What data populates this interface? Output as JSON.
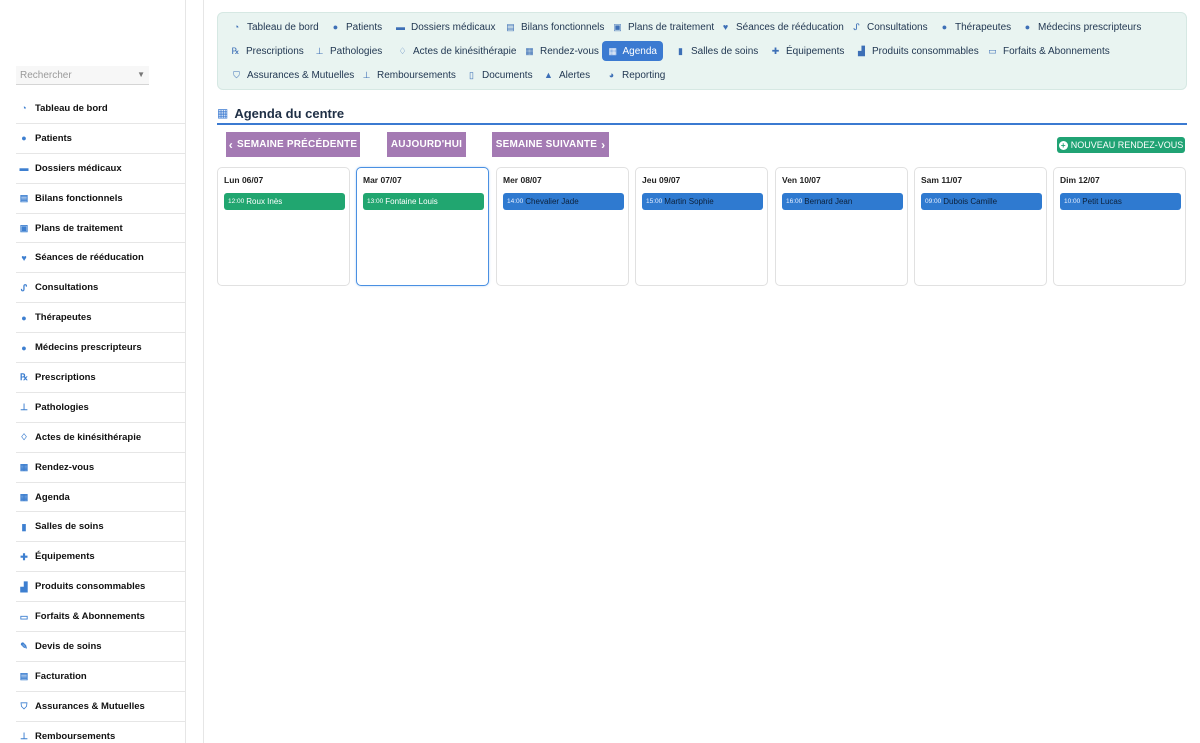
{
  "search": {
    "placeholder": "Rechercher"
  },
  "sidebar": {
    "items": [
      {
        "label": "Tableau de bord",
        "icon": "dashboard-icon"
      },
      {
        "label": "Patients",
        "icon": "user-icon"
      },
      {
        "label": "Dossiers médicaux",
        "icon": "folder-icon"
      },
      {
        "label": "Bilans fonctionnels",
        "icon": "clipboard-icon"
      },
      {
        "label": "Plans de traitement",
        "icon": "clipboard-plus-icon"
      },
      {
        "label": "Séances de rééducation",
        "icon": "heart-icon"
      },
      {
        "label": "Consultations",
        "icon": "stethoscope-icon"
      },
      {
        "label": "Thérapeutes",
        "icon": "doctor-icon"
      },
      {
        "label": "Médecins prescripteurs",
        "icon": "doctor-icon"
      },
      {
        "label": "Prescriptions",
        "icon": "prescription-icon"
      },
      {
        "label": "Pathologies",
        "icon": "procedures-icon"
      },
      {
        "label": "Actes de kinésithérapie",
        "icon": "hands-icon"
      },
      {
        "label": "Rendez-vous",
        "icon": "calendar-check-icon"
      },
      {
        "label": "Agenda",
        "icon": "calendar-icon"
      },
      {
        "label": "Salles de soins",
        "icon": "door-icon"
      },
      {
        "label": "Équipements",
        "icon": "medkit-icon"
      },
      {
        "label": "Produits consommables",
        "icon": "boxes-icon"
      },
      {
        "label": "Forfaits & Abonnements",
        "icon": "card-icon"
      },
      {
        "label": "Devis de soins",
        "icon": "invoice-icon"
      },
      {
        "label": "Facturation",
        "icon": "receipt-icon"
      },
      {
        "label": "Assurances & Mutuelles",
        "icon": "shield-icon"
      },
      {
        "label": "Remboursements",
        "icon": "hand-money-icon"
      }
    ]
  },
  "topnav": {
    "items": [
      {
        "label": "Tableau de bord",
        "icon": "dashboard-icon"
      },
      {
        "label": "Patients",
        "icon": "user-icon"
      },
      {
        "label": "Dossiers médicaux",
        "icon": "folder-icon"
      },
      {
        "label": "Bilans fonctionnels",
        "icon": "clipboard-icon"
      },
      {
        "label": "Plans de traitement",
        "icon": "clipboard-plus-icon"
      },
      {
        "label": "Séances de rééducation",
        "icon": "heart-icon"
      },
      {
        "label": "Consultations",
        "icon": "stethoscope-icon"
      },
      {
        "label": "Thérapeutes",
        "icon": "doctor-icon"
      },
      {
        "label": "Médecins prescripteurs",
        "icon": "doctor-icon"
      },
      {
        "label": "Prescriptions",
        "icon": "prescription-icon"
      },
      {
        "label": "Pathologies",
        "icon": "procedures-icon"
      },
      {
        "label": "Actes de kinésithérapie",
        "icon": "hands-icon"
      },
      {
        "label": "Rendez-vous",
        "icon": "calendar-check-icon"
      },
      {
        "label": "Agenda",
        "icon": "calendar-icon",
        "active": true
      },
      {
        "label": "Salles de soins",
        "icon": "door-icon"
      },
      {
        "label": "Équipements",
        "icon": "medkit-icon"
      },
      {
        "label": "Produits consommables",
        "icon": "boxes-icon"
      },
      {
        "label": "Forfaits & Abonnements",
        "icon": "card-icon"
      },
      {
        "label": "Assurances & Mutuelles",
        "icon": "shield-icon"
      },
      {
        "label": "Remboursements",
        "icon": "hand-money-icon"
      },
      {
        "label": "Documents",
        "icon": "document-icon"
      },
      {
        "label": "Alertes",
        "icon": "warning-icon"
      },
      {
        "label": "Reporting",
        "icon": "pie-chart-icon"
      }
    ]
  },
  "page": {
    "title": "Agenda du centre"
  },
  "toolbar": {
    "prev_label": "SEMAINE PRÉCÉDENTE",
    "today_label": "AUJOURD'HUI",
    "next_label": "SEMAINE SUIVANTE",
    "new_label": "NOUVEAU RENDEZ-VOUS"
  },
  "colors": {
    "accent": "#3b7ad1",
    "button": "#a47ab3",
    "new_button": "#20a374",
    "appt_green": "#21a670",
    "appt_blue": "#2f7ad0"
  },
  "week": [
    {
      "day": "Lun 06/07",
      "appt": {
        "time": "12:00",
        "name": "Roux Inès",
        "color": "green"
      }
    },
    {
      "day": "Mar 07/07",
      "appt": {
        "time": "13:00",
        "name": "Fontaine Louis",
        "color": "green"
      },
      "selected": true
    },
    {
      "day": "Mer 08/07",
      "appt": {
        "time": "14:00",
        "name": "Chevalier Jade",
        "color": "blue"
      }
    },
    {
      "day": "Jeu 09/07",
      "appt": {
        "time": "15:00",
        "name": "Martin Sophie",
        "color": "blue"
      }
    },
    {
      "day": "Ven 10/07",
      "appt": {
        "time": "16:00",
        "name": "Bernard Jean",
        "color": "blue"
      }
    },
    {
      "day": "Sam 11/07",
      "appt": {
        "time": "09:00",
        "name": "Dubois Camille",
        "color": "blue"
      }
    },
    {
      "day": "Dim 12/07",
      "appt": {
        "time": "10:00",
        "name": "Petit Lucas",
        "color": "blue"
      }
    }
  ]
}
